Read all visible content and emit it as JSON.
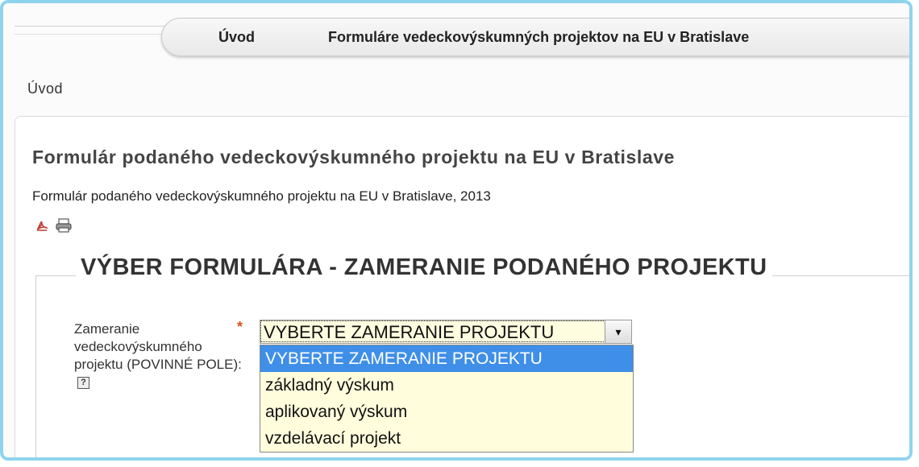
{
  "nav": {
    "home": "Úvod",
    "forms": "Formuláre vedeckovýskumných projektov na EU v Bratislave"
  },
  "breadcrumb": "Úvod",
  "page": {
    "title": "Formulár podaného vedeckovýskumného projektu na EU v Bratislave",
    "subtitle": "Formulár podaného vedeckovýskumného projektu na EU v Bratislave, 2013"
  },
  "icons": [
    "pdf-icon",
    "print-icon",
    "help-icon",
    "chevron-down-icon"
  ],
  "form": {
    "legend": "VÝBER FORMULÁRA - ZAMERANIE PODANÉHO PROJEKTU",
    "field_label": "Zameranie vedeckovýskumného projektu (POVINNÉ POLE):",
    "required_mark": "*",
    "help_mark": "?",
    "select_value": "VYBERTE ZAMERANIE PROJEKTU",
    "options": [
      "VYBERTE ZAMERANIE PROJEKTU",
      "základný výskum",
      "aplikovaný výskum",
      "vzdelávací projekt"
    ]
  },
  "colors": {
    "frame": "#8fd4ee",
    "selected_option": "#3f8fe8",
    "dropdown_bg": "#fffddc",
    "required": "#d9531e"
  }
}
